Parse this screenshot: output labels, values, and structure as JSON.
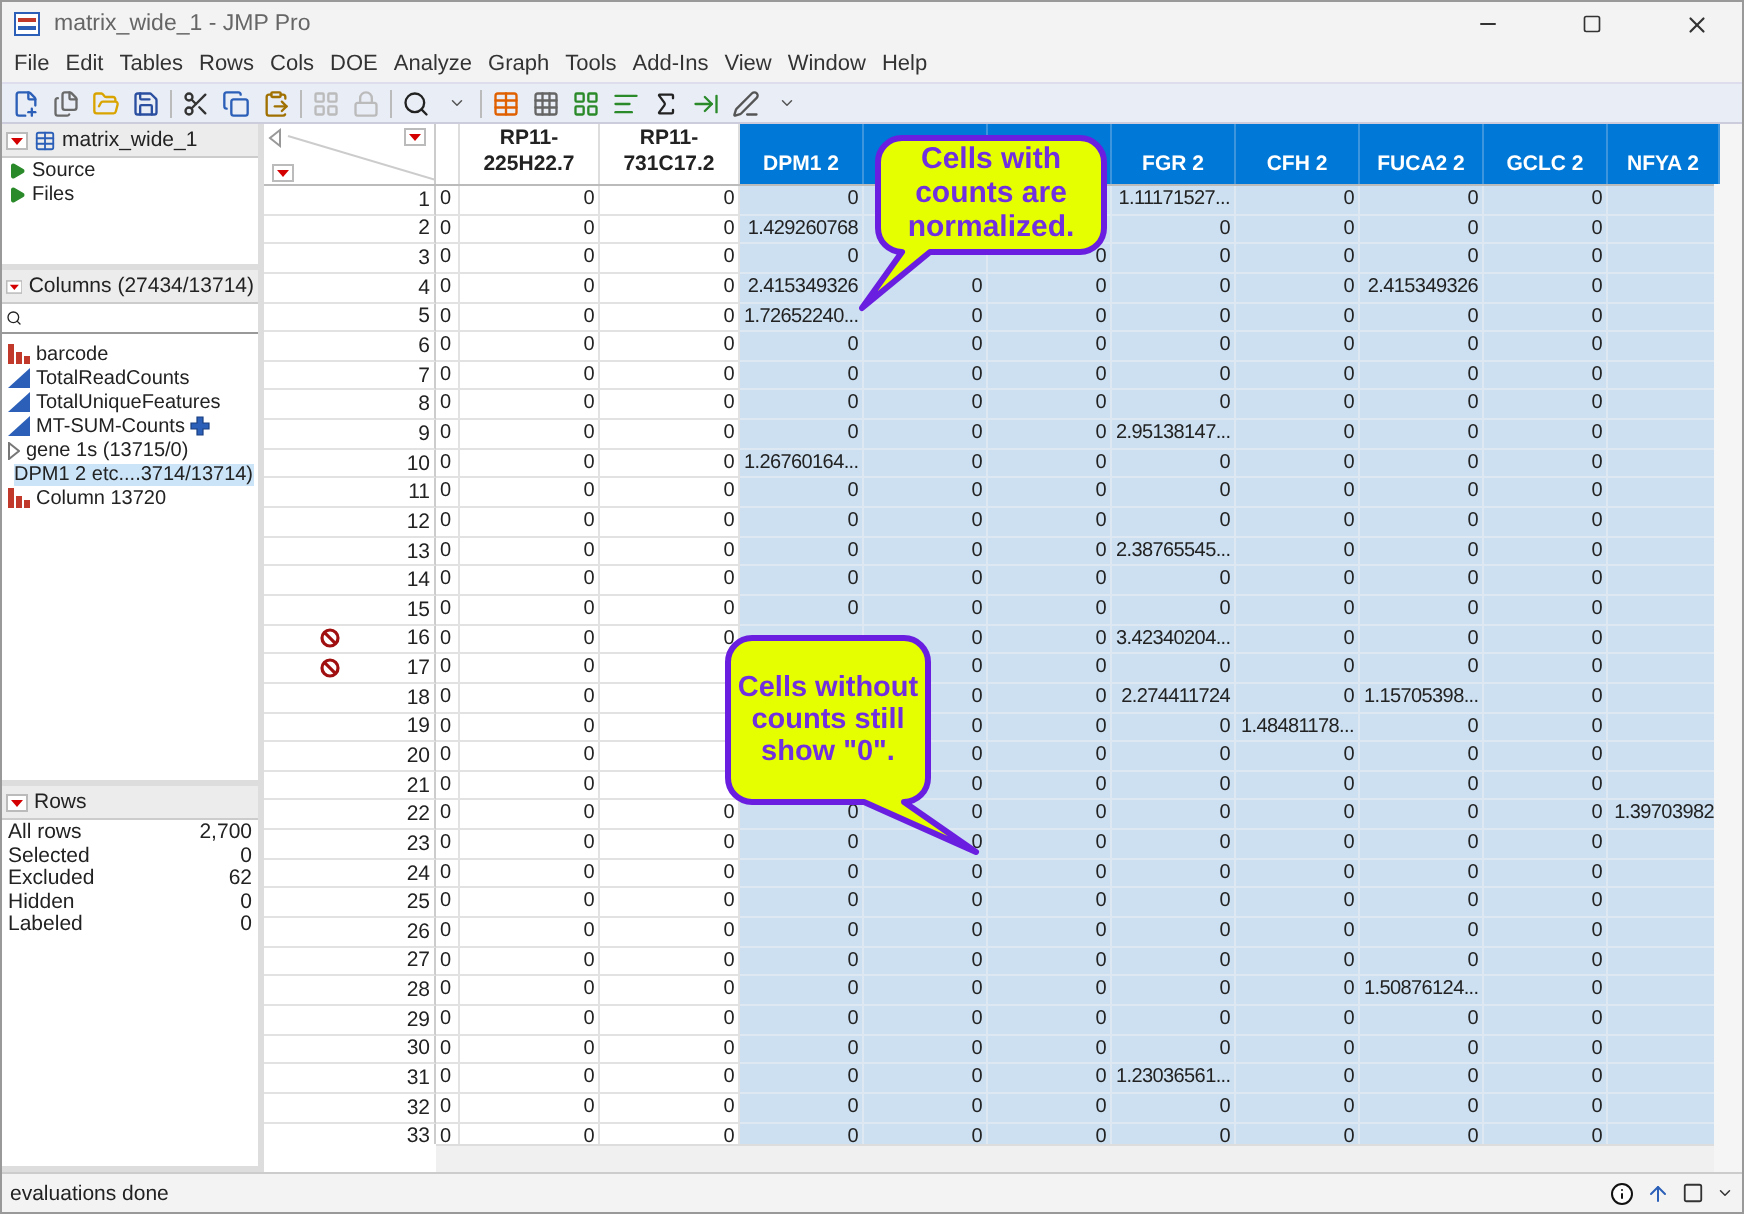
{
  "window": {
    "title": "matrix_wide_1 - JMP Pro"
  },
  "menu": [
    "File",
    "Edit",
    "Tables",
    "Rows",
    "Cols",
    "DOE",
    "Analyze",
    "Graph",
    "Tools",
    "Add-Ins",
    "View",
    "Window",
    "Help"
  ],
  "table_panel": {
    "name": "matrix_wide_1",
    "items": [
      "Source",
      "Files"
    ]
  },
  "columns_panel": {
    "title": "Columns (27434/13714)",
    "items": [
      {
        "label": "barcode",
        "kind": "nominal",
        "selected": false
      },
      {
        "label": "TotalReadCounts",
        "kind": "continuous",
        "selected": false
      },
      {
        "label": "TotalUniqueFeatures",
        "kind": "continuous",
        "selected": false
      },
      {
        "label": "MT-SUM-Counts",
        "kind": "formula",
        "selected": false
      },
      {
        "label": "gene 1s (13715/0)",
        "kind": "group",
        "selected": false
      },
      {
        "label": "DPM1 2 etc....3714/13714)",
        "kind": "group",
        "selected": true
      },
      {
        "label": "Column 13720",
        "kind": "nominal",
        "selected": false
      }
    ]
  },
  "rows_panel": {
    "title": "Rows",
    "items": [
      {
        "label": "All rows",
        "value": "2,700"
      },
      {
        "label": "Selected",
        "value": "0"
      },
      {
        "label": "Excluded",
        "value": "62"
      },
      {
        "label": "Hidden",
        "value": "0"
      },
      {
        "label": "Labeled",
        "value": "0"
      }
    ]
  },
  "table": {
    "columns": [
      {
        "selected": false
      },
      {
        "name": "RP11-225H22.7",
        "selected": false
      },
      {
        "name": "RP11-731C17.2",
        "selected": false
      },
      {
        "name": "DPM1 2",
        "selected": true
      },
      {
        "selected": true
      },
      {
        "selected": true
      },
      {
        "name": "FGR 2",
        "selected": true
      },
      {
        "name": "CFH 2",
        "selected": true
      },
      {
        "name": "FUCA2 2",
        "selected": true
      },
      {
        "name": "GCLC 2",
        "selected": true
      },
      {
        "name": "NFYA 2",
        "selected": true
      }
    ],
    "rows": [
      {
        "number": "1",
        "excluded": false,
        "cells": [
          "0",
          "0",
          "0",
          "0",
          null,
          null,
          "1.11171527...",
          "0",
          "0",
          "0",
          null
        ]
      },
      {
        "number": "2",
        "excluded": false,
        "cells": [
          "0",
          "0",
          "0",
          "1.429260768",
          null,
          null,
          "0",
          "0",
          "0",
          "0",
          null
        ]
      },
      {
        "number": "3",
        "excluded": false,
        "cells": [
          "0",
          "0",
          "0",
          "0",
          null,
          "0",
          "0",
          "0",
          "0",
          "0",
          null
        ]
      },
      {
        "number": "4",
        "excluded": false,
        "cells": [
          "0",
          "0",
          "0",
          "2.415349326",
          "0",
          "0",
          "0",
          "0",
          "2.415349326",
          "0",
          null
        ]
      },
      {
        "number": "5",
        "excluded": false,
        "cells": [
          "0",
          "0",
          "0",
          "1.72652240...",
          "0",
          "0",
          "0",
          "0",
          "0",
          "0",
          null
        ]
      },
      {
        "number": "6",
        "excluded": false,
        "cells": [
          "0",
          "0",
          "0",
          "0",
          "0",
          "0",
          "0",
          "0",
          "0",
          "0",
          null
        ]
      },
      {
        "number": "7",
        "excluded": false,
        "cells": [
          "0",
          "0",
          "0",
          "0",
          "0",
          "0",
          "0",
          "0",
          "0",
          "0",
          null
        ]
      },
      {
        "number": "8",
        "excluded": false,
        "cells": [
          "0",
          "0",
          "0",
          "0",
          "0",
          "0",
          "0",
          "0",
          "0",
          "0",
          null
        ]
      },
      {
        "number": "9",
        "excluded": false,
        "cells": [
          "0",
          "0",
          "0",
          "0",
          "0",
          "0",
          "2.95138147...",
          "0",
          "0",
          "0",
          null
        ]
      },
      {
        "number": "10",
        "excluded": false,
        "cells": [
          "0",
          "0",
          "0",
          "1.26760164...",
          "0",
          "0",
          "0",
          "0",
          "0",
          "0",
          null
        ]
      },
      {
        "number": "11",
        "excluded": false,
        "cells": [
          "0",
          "0",
          "0",
          "0",
          "0",
          "0",
          "0",
          "0",
          "0",
          "0",
          null
        ]
      },
      {
        "number": "12",
        "excluded": false,
        "cells": [
          "0",
          "0",
          "0",
          "0",
          "0",
          "0",
          "0",
          "0",
          "0",
          "0",
          null
        ]
      },
      {
        "number": "13",
        "excluded": false,
        "cells": [
          "0",
          "0",
          "0",
          "0",
          "0",
          "0",
          "2.38765545...",
          "0",
          "0",
          "0",
          null
        ]
      },
      {
        "number": "14",
        "excluded": false,
        "cells": [
          "0",
          "0",
          "0",
          "0",
          "0",
          "0",
          "0",
          "0",
          "0",
          "0",
          null
        ]
      },
      {
        "number": "15",
        "excluded": false,
        "cells": [
          "0",
          "0",
          "0",
          "0",
          "0",
          "0",
          "0",
          "0",
          "0",
          "0",
          null
        ]
      },
      {
        "number": "16",
        "excluded": true,
        "cells": [
          "0",
          "0",
          "0",
          null,
          "0",
          "0",
          "3.42340204...",
          "0",
          "0",
          "0",
          null
        ]
      },
      {
        "number": "17",
        "excluded": true,
        "cells": [
          "0",
          "0",
          null,
          null,
          "0",
          "0",
          "0",
          "0",
          "0",
          "0",
          null
        ]
      },
      {
        "number": "18",
        "excluded": false,
        "cells": [
          "0",
          "0",
          null,
          null,
          "0",
          "0",
          "2.274411724",
          "0",
          "1.15705398...",
          "0",
          null
        ]
      },
      {
        "number": "19",
        "excluded": false,
        "cells": [
          "0",
          "0",
          null,
          null,
          "0",
          "0",
          "0",
          "1.48481178...",
          "0",
          "0",
          null
        ]
      },
      {
        "number": "20",
        "excluded": false,
        "cells": [
          "0",
          "0",
          null,
          null,
          "0",
          "0",
          "0",
          "0",
          "0",
          "0",
          null
        ]
      },
      {
        "number": "21",
        "excluded": false,
        "cells": [
          "0",
          "0",
          null,
          null,
          "0",
          "0",
          "0",
          "0",
          "0",
          "0",
          null
        ]
      },
      {
        "number": "22",
        "excluded": false,
        "cells": [
          "0",
          "0",
          "0",
          "0",
          "0",
          "0",
          "0",
          "0",
          "0",
          "0",
          "1.39703982"
        ]
      },
      {
        "number": "23",
        "excluded": false,
        "cells": [
          "0",
          "0",
          "0",
          "0",
          "0",
          "0",
          "0",
          "0",
          "0",
          "0",
          null
        ]
      },
      {
        "number": "24",
        "excluded": false,
        "cells": [
          "0",
          "0",
          "0",
          "0",
          "0",
          "0",
          "0",
          "0",
          "0",
          "0",
          null
        ]
      },
      {
        "number": "25",
        "excluded": false,
        "cells": [
          "0",
          "0",
          "0",
          "0",
          "0",
          "0",
          "0",
          "0",
          "0",
          "0",
          null
        ]
      },
      {
        "number": "26",
        "excluded": false,
        "cells": [
          "0",
          "0",
          "0",
          "0",
          "0",
          "0",
          "0",
          "0",
          "0",
          "0",
          null
        ]
      },
      {
        "number": "27",
        "excluded": false,
        "cells": [
          "0",
          "0",
          "0",
          "0",
          "0",
          "0",
          "0",
          "0",
          "0",
          "0",
          null
        ]
      },
      {
        "number": "28",
        "excluded": false,
        "cells": [
          "0",
          "0",
          "0",
          "0",
          "0",
          "0",
          "0",
          "0",
          "1.50876124...",
          "0",
          null
        ]
      },
      {
        "number": "29",
        "excluded": false,
        "cells": [
          "0",
          "0",
          "0",
          "0",
          "0",
          "0",
          "0",
          "0",
          "0",
          "0",
          null
        ]
      },
      {
        "number": "30",
        "excluded": false,
        "cells": [
          "0",
          "0",
          "0",
          "0",
          "0",
          "0",
          "0",
          "0",
          "0",
          "0",
          null
        ]
      },
      {
        "number": "31",
        "excluded": false,
        "cells": [
          "0",
          "0",
          "0",
          "0",
          "0",
          "0",
          "1.23036561...",
          "0",
          "0",
          "0",
          null
        ]
      },
      {
        "number": "32",
        "excluded": false,
        "cells": [
          "0",
          "0",
          "0",
          "0",
          "0",
          "0",
          "0",
          "0",
          "0",
          "0",
          null
        ]
      },
      {
        "number": "33",
        "excluded": false,
        "cells": [
          "0",
          "0",
          "0",
          "0",
          "0",
          "0",
          "0",
          "0",
          "0",
          "0",
          null
        ]
      }
    ]
  },
  "callouts": [
    {
      "text": "Cells with counts are normalized."
    },
    {
      "text": "Cells without counts still show \"0\"."
    }
  ],
  "status_bar": {
    "text": "evaluations done"
  }
}
